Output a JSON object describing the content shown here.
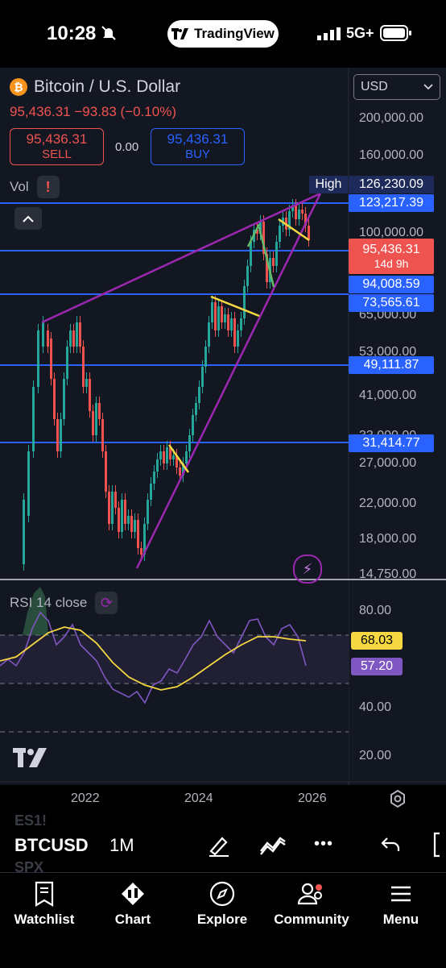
{
  "status": {
    "time": "10:28",
    "app_pill": "TradingView",
    "network": "5G+"
  },
  "header": {
    "title": "Bitcoin / U.S. Dollar",
    "price_line": "95,436.31 −93.83 (−0.10%)",
    "sell_price": "95,436.31",
    "sell_label": "SELL",
    "spread": "0.00",
    "buy_price": "95,436.31",
    "buy_label": "BUY",
    "vol_label": "Vol",
    "currency": "USD"
  },
  "axis_labels": [
    "200,000.00",
    "160,000.00",
    "100,000.00",
    "65,000.00",
    "53,000.00",
    "41,000.00",
    "33,000.00",
    "27,000.00",
    "22,000.00",
    "18,000.00",
    "14,750.00"
  ],
  "price_tags": {
    "high_label": "High",
    "high_value": "126,230.09",
    "level1": "123,217.39",
    "current": "95,436.31",
    "countdown": "14d 9h",
    "level2": "94,008.59",
    "level3": "73,565.61",
    "level4": "49,111.87",
    "level5": "31,414.77"
  },
  "rsi": {
    "label": "RSI 14 close",
    "axis": [
      "80.00",
      "40.00",
      "20.00"
    ],
    "value_yellow": "68.03",
    "value_purple": "57.20"
  },
  "x_axis": [
    "2022",
    "2024",
    "2026"
  ],
  "toolbar": {
    "symbol": "BTCUSD",
    "interval": "1M",
    "ghost_top": "ES1!",
    "ghost_bottom": "SPX",
    "more": "•••"
  },
  "tabs": [
    "Watchlist",
    "Chart",
    "Explore",
    "Community",
    "Menu"
  ],
  "colors": {
    "up": "#26a69a",
    "down": "#ef5350",
    "level_line": "#2962ff",
    "wedge": "#9c27b0",
    "rsi_ma": "#f5d742",
    "rsi": "#7e57c2"
  }
}
